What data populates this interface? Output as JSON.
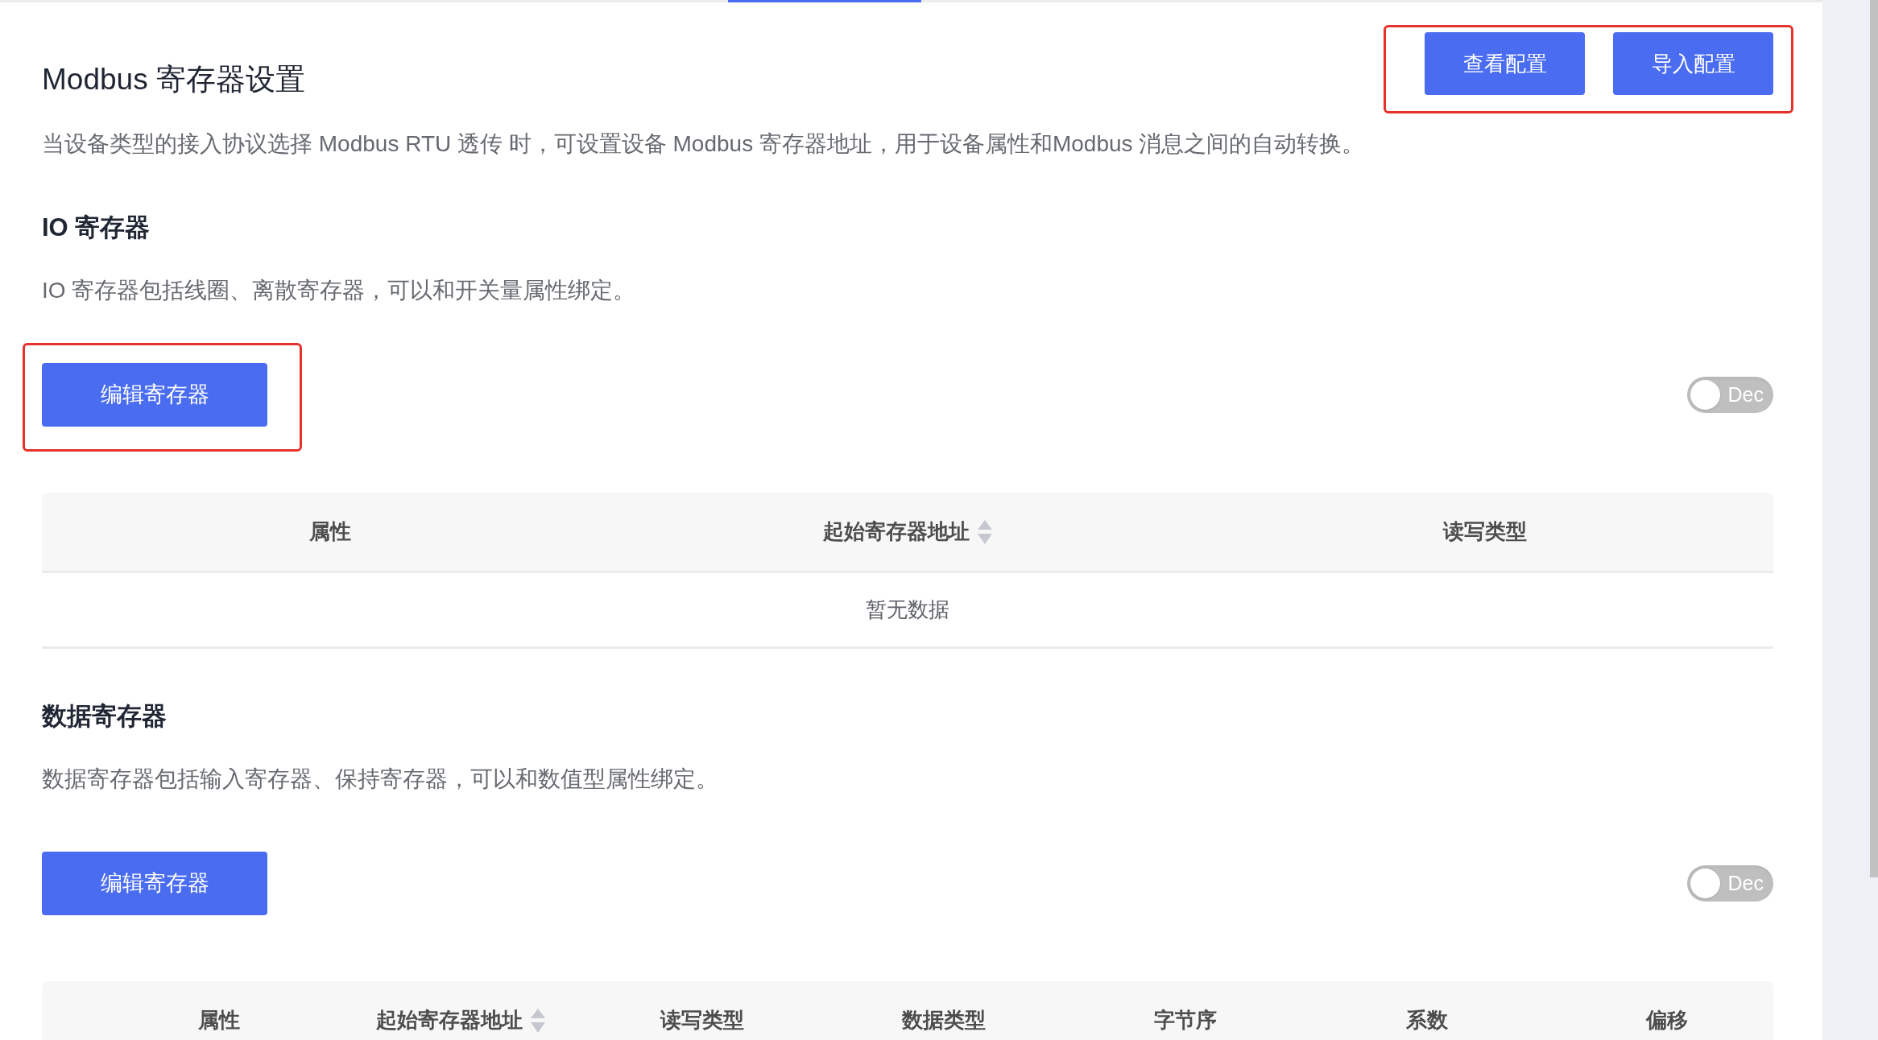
{
  "page": {
    "title": "Modbus 寄存器设置",
    "description": "当设备类型的接入协议选择 Modbus RTU 透传 时，可设置设备 Modbus 寄存器地址，用于设备属性和Modbus 消息之间的自动转换。",
    "actions_highlighted": true,
    "actions": [
      {
        "label": "查看配置"
      },
      {
        "label": "导入配置"
      }
    ]
  },
  "sections": [
    {
      "title": "IO 寄存器",
      "description": "IO 寄存器包括线圈、离散寄存器，可以和开关量属性绑定。",
      "edit_button": {
        "label": "编辑寄存器",
        "highlighted": true
      },
      "toggle": {
        "label": "Dec",
        "on": false
      },
      "table": {
        "columns": [
          {
            "label": "属性",
            "kind": "plain"
          },
          {
            "label": "起始寄存器地址",
            "kind": "sortable"
          },
          {
            "label": "读写类型",
            "kind": "plain"
          }
        ],
        "empty_text": "暂无数据"
      }
    },
    {
      "title": "数据寄存器",
      "description": "数据寄存器包括输入寄存器、保持寄存器，可以和数值型属性绑定。",
      "edit_button": {
        "label": "编辑寄存器",
        "highlighted": false
      },
      "toggle": {
        "label": "Dec",
        "on": false
      },
      "table": {
        "columns": [
          {
            "label": "属性",
            "kind": "plain"
          },
          {
            "label": "起始寄存器地址",
            "kind": "sortable"
          },
          {
            "label": "读写类型",
            "kind": "plain"
          },
          {
            "label": "数据类型",
            "kind": "plain"
          },
          {
            "label": "字节序",
            "kind": "plain"
          },
          {
            "label": "系数",
            "kind": "plain"
          },
          {
            "label": "偏移",
            "kind": "plain"
          }
        ]
      }
    }
  ]
}
